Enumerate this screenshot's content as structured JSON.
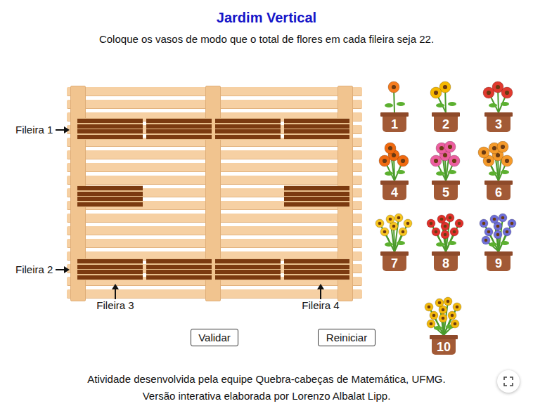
{
  "title": "Jardim Vertical",
  "instruction": "Coloque os vasos de modo que o total de flores em cada fileira seja 22.",
  "row_labels": [
    {
      "label": "Fileira 1",
      "kind": "left"
    },
    {
      "label": "Fileira 2",
      "kind": "left"
    },
    {
      "label": "Fileira 3",
      "kind": "bottom"
    },
    {
      "label": "Fileira 4",
      "kind": "bottom"
    }
  ],
  "slots": [
    {
      "filled": false
    },
    {
      "filled": false
    },
    {
      "filled": false
    },
    {
      "filled": false
    },
    {
      "filled": false
    },
    {
      "filled": false
    },
    {
      "filled": false
    },
    {
      "filled": false
    },
    {
      "filled": false
    },
    {
      "filled": false
    }
  ],
  "pots": [
    {
      "number": "1",
      "color": "#f57c1f"
    },
    {
      "number": "2",
      "color": "#f5b800"
    },
    {
      "number": "3",
      "color": "#e03a2f"
    },
    {
      "number": "4",
      "color": "#f06a10"
    },
    {
      "number": "5",
      "color": "#ec5fa0"
    },
    {
      "number": "6",
      "color": "#f59a2a"
    },
    {
      "number": "7",
      "color": "#f7c520"
    },
    {
      "number": "8",
      "color": "#e0302a"
    },
    {
      "number": "9",
      "color": "#6f6fd8"
    },
    {
      "number": "10",
      "color": "#f2b90c"
    }
  ],
  "buttons": [
    "Validar",
    "Reiniciar"
  ],
  "footer": [
    "Atividade desenvolvida pela equipe Quebra-cabeças de Matemática, UFMG.",
    "Versão interativa elaborada por Lorenzo Albalat Lipp."
  ]
}
